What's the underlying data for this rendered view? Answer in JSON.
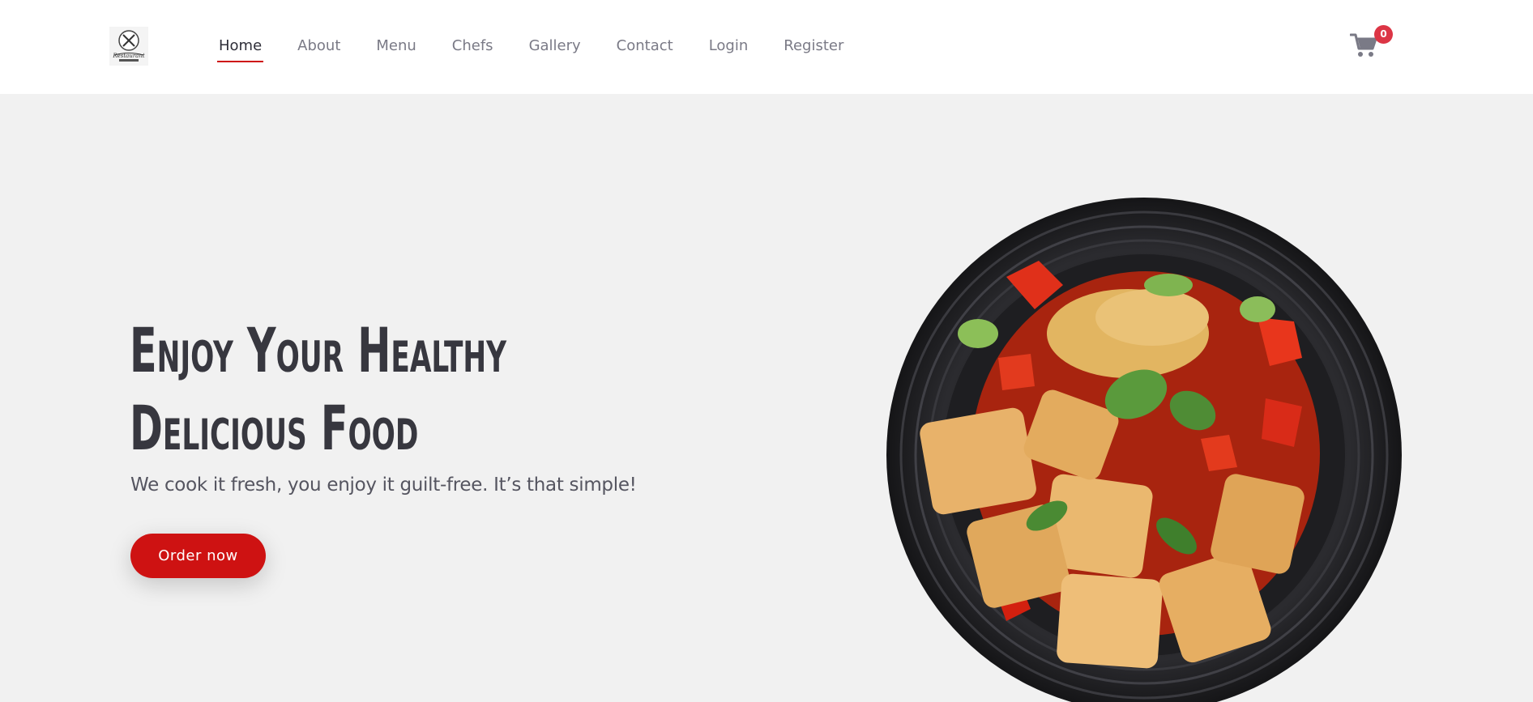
{
  "header": {
    "logo_name": "restaurant-logo",
    "logo_text": "Restaurant",
    "nav": [
      {
        "label": "Home",
        "active": true
      },
      {
        "label": "About",
        "active": false
      },
      {
        "label": "Menu",
        "active": false
      },
      {
        "label": "Chefs",
        "active": false
      },
      {
        "label": "Gallery",
        "active": false
      },
      {
        "label": "Contact",
        "active": false
      },
      {
        "label": "Login",
        "active": false
      },
      {
        "label": "Register",
        "active": false
      }
    ],
    "cart": {
      "icon": "cart-icon",
      "count": "0"
    }
  },
  "hero": {
    "title_line1": "Enjoy Your Healthy",
    "title_line2": "Delicious Food",
    "subtitle": "We cook it fresh, you enjoy it guilt-free. It’s that simple!",
    "cta_label": "Order now",
    "image": "food-bowl-image"
  },
  "colors": {
    "accent": "#ce1212",
    "badge": "#dc3545",
    "background": "#f1f1f1",
    "nav_text": "#7a7a86",
    "title_text": "#37373f"
  }
}
